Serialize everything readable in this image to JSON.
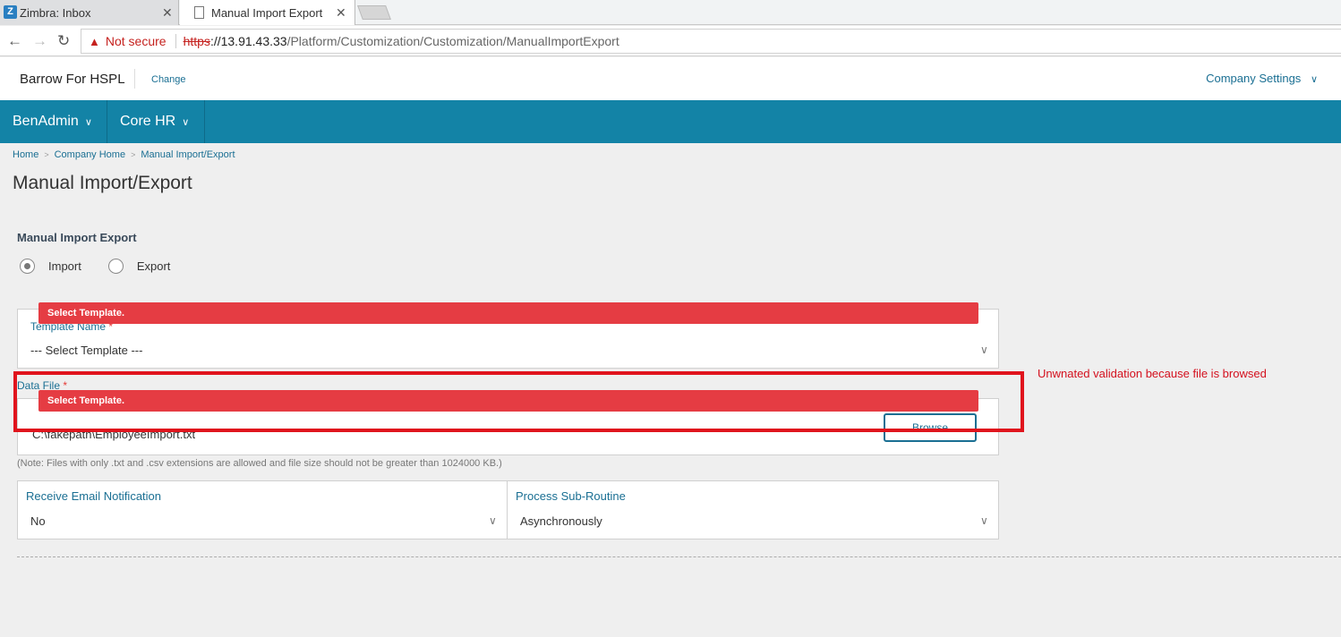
{
  "browser": {
    "tabs": [
      {
        "title": "Zimbra: Inbox",
        "favicon": "Z"
      },
      {
        "title": "Manual Import Export"
      }
    ],
    "close_glyph": "✕",
    "security_label": "Not secure",
    "url_scheme": "https",
    "url_host": "://13.91.43.33",
    "url_path": "/Platform/Customization/Customization/ManualImportExport"
  },
  "header": {
    "company_name": "Barrow For HSPL",
    "change_label": "Change",
    "settings_label": "Company Settings"
  },
  "nav": {
    "items": [
      {
        "label": "BenAdmin"
      },
      {
        "label": "Core HR"
      }
    ]
  },
  "breadcrumb": [
    "Home",
    "Company Home",
    "Manual Import/Export"
  ],
  "page_title": "Manual Import/Export",
  "section": {
    "title": "Manual Import Export",
    "radio_options": [
      {
        "label": "Import",
        "selected": true
      },
      {
        "label": "Export",
        "selected": false
      }
    ]
  },
  "template": {
    "label": "Template Name",
    "required_mark": "*",
    "value": "--- Select Template ---",
    "error": "Select Template."
  },
  "data_file": {
    "label": "Data File",
    "required_mark": "*",
    "error": "Select Template.",
    "path": "C:\\fakepath\\EmployeeImport.txt",
    "browse_label": "Browse",
    "note": "(Note: Files with only .txt and .csv extensions are allowed and file size should not be greater than 1024000 KB.)"
  },
  "email_notification": {
    "label": "Receive Email Notification",
    "value": "No"
  },
  "sub_routine": {
    "label": "Process Sub-Routine",
    "value": "Asynchronously"
  },
  "annotation": {
    "text": "Unwnated validation because file is browsed",
    "color": "#e0141d"
  },
  "colors": {
    "nav_bg": "#1383a6",
    "link": "#1a6f93",
    "error_bg": "#e53c43"
  }
}
